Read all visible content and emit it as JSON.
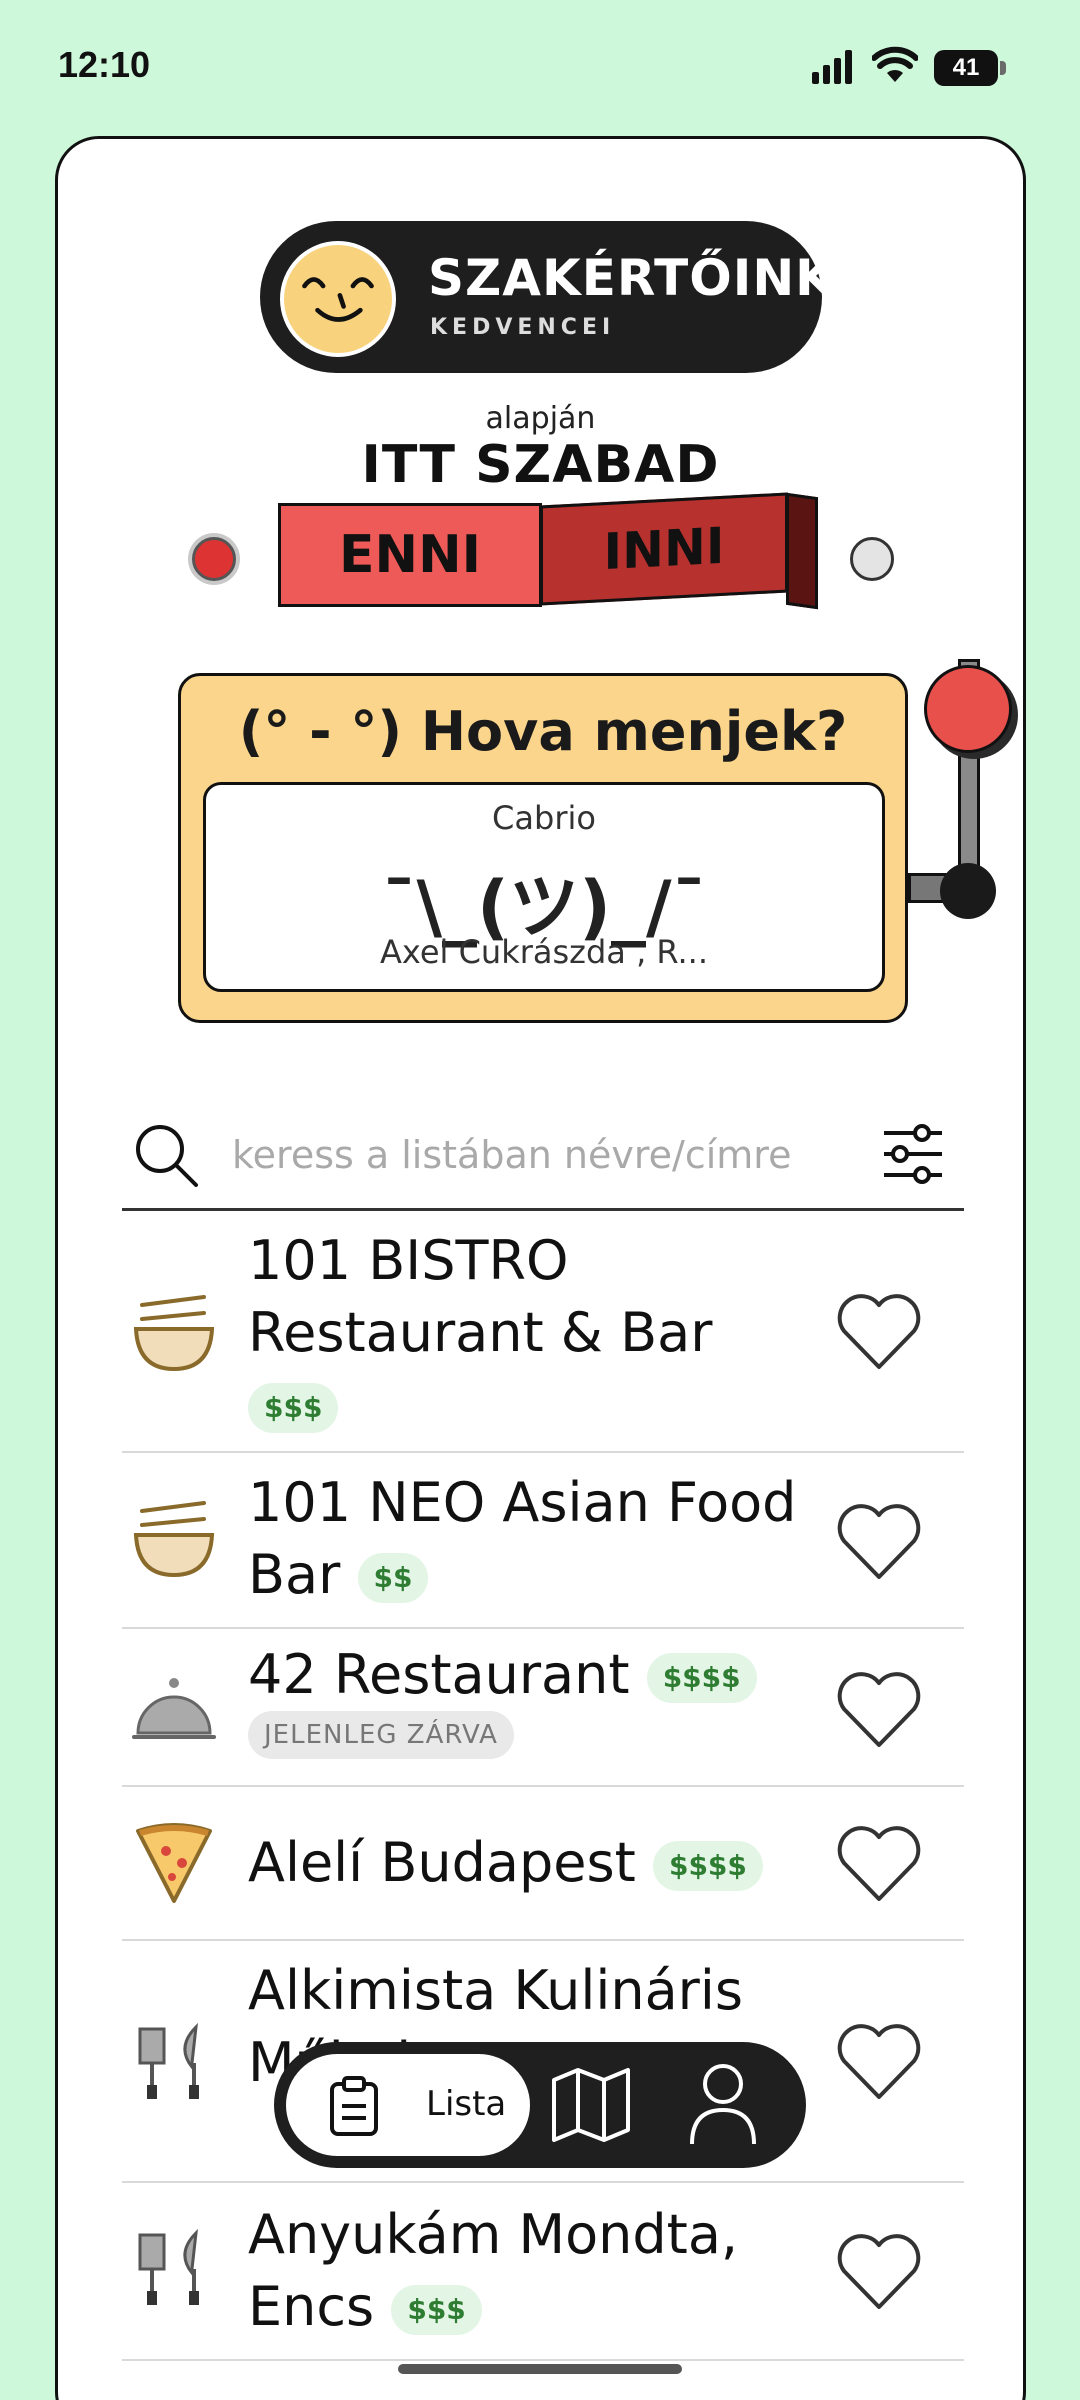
{
  "status": {
    "time": "12:10",
    "battery": "41"
  },
  "header": {
    "logo_title": "SZAKÉRTŐINK",
    "logo_sub": "KEDVENCEI",
    "alapjan": "alapján",
    "headline": "ITT SZABAD",
    "toggle_enni": "ENNI",
    "toggle_inni": "INNI",
    "active_mode": "ENNI"
  },
  "slot": {
    "question": "(° - °) Hova menjek?",
    "top": "Cabrio",
    "middle": "¯\\_(ツ)_/¯",
    "bottom": "Axel Cukrászda , R..."
  },
  "search": {
    "placeholder": "keress a listában névre/címre",
    "value": ""
  },
  "list": [
    {
      "icon": "bowl-icon",
      "name": "101 BISTRO Restaurant & Bar",
      "price": "$$$",
      "closed": ""
    },
    {
      "icon": "bowl-icon",
      "name": "101 NEO Asian Food Bar",
      "price": "$$",
      "closed": ""
    },
    {
      "icon": "cloche-icon",
      "name": "42 Restaurant",
      "price": "$$$$",
      "closed": "JELENLEG ZÁRVA"
    },
    {
      "icon": "pizza-icon",
      "name": "Alelí Budapest",
      "price": "$$$$",
      "closed": ""
    },
    {
      "icon": "cutlery-icon",
      "name": "Alkimista Kulináris Műhely",
      "price": "",
      "closed": ""
    },
    {
      "icon": "cutlery-icon",
      "name": "Anyukám Mondta, Encs",
      "price": "$$$",
      "closed": ""
    }
  ],
  "nav": {
    "lista_label": "Lista",
    "active": "Lista"
  },
  "colors": {
    "background": "#cdf8d9",
    "accent_red": "#ee5a57",
    "slot_yellow": "#fad58b",
    "price_green": "#2e7d32"
  }
}
